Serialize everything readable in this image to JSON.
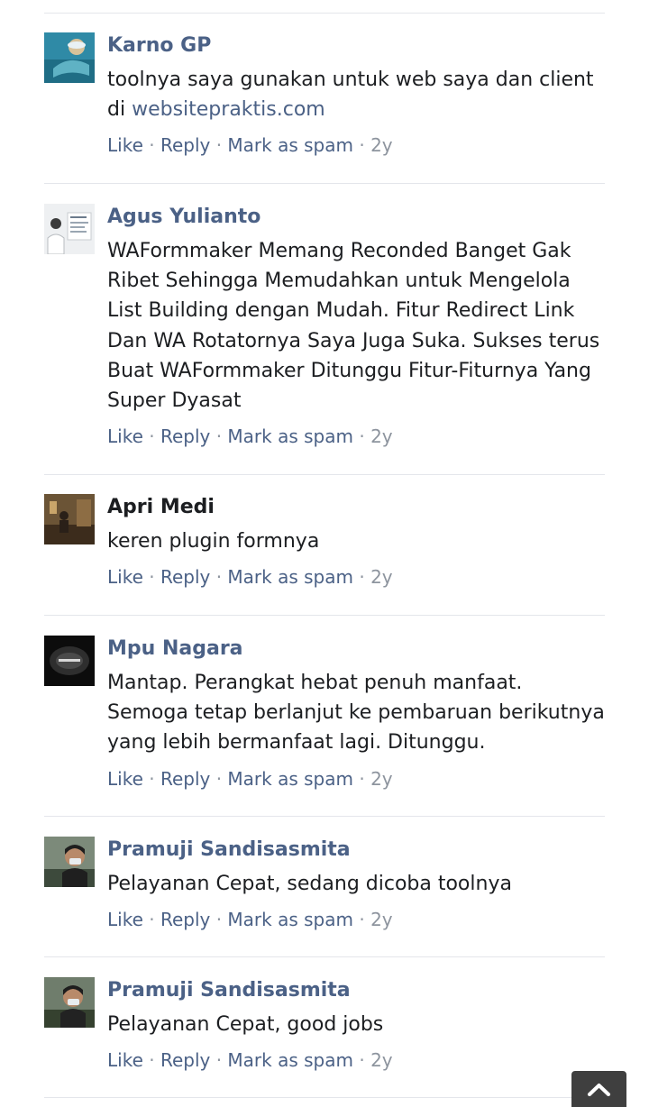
{
  "comments": [
    {
      "author": "Karno GP",
      "text": "toolnya saya gunakan untuk web saya dan client di",
      "link": "websitepraktis.com",
      "actions": {
        "like": "Like",
        "reply": "Reply",
        "spam": "Mark as spam",
        "time": "2y"
      }
    },
    {
      "author": "Agus Yulianto",
      "text": "WAFormmaker Memang Reconded Banget Gak Ribet Sehingga Memudahkan untuk Mengelola List Building dengan Mudah. Fitur Redirect Link Dan WA Rotatornya Saya Juga Suka. Sukses terus Buat WAFormmaker Ditunggu Fitur-Fiturnya Yang Super Dyasat",
      "actions": {
        "like": "Like",
        "reply": "Reply",
        "spam": "Mark as spam",
        "time": "2y"
      }
    },
    {
      "author": "Apri Medi",
      "text": "keren plugin formnya",
      "actions": {
        "like": "Like",
        "reply": "Reply",
        "spam": "Mark as spam",
        "time": "2y"
      }
    },
    {
      "author": "Mpu Nagara",
      "text": "Mantap. Perangkat hebat penuh manfaat. Semoga tetap berlanjut ke pembaruan berikutnya yang lebih bermanfaat lagi. Ditunggu.",
      "actions": {
        "like": "Like",
        "reply": "Reply",
        "spam": "Mark as spam",
        "time": "2y"
      }
    },
    {
      "author": "Pramuji Sandisasmita",
      "text": "Pelayanan Cepat, sedang dicoba toolnya",
      "actions": {
        "like": "Like",
        "reply": "Reply",
        "spam": "Mark as spam",
        "time": "2y"
      }
    },
    {
      "author": "Pramuji Sandisasmita",
      "text": "Pelayanan Cepat, good jobs",
      "actions": {
        "like": "Like",
        "reply": "Reply",
        "spam": "Mark as spam",
        "time": "2y"
      }
    }
  ],
  "scroll_top_icon": "chevron-up-icon"
}
